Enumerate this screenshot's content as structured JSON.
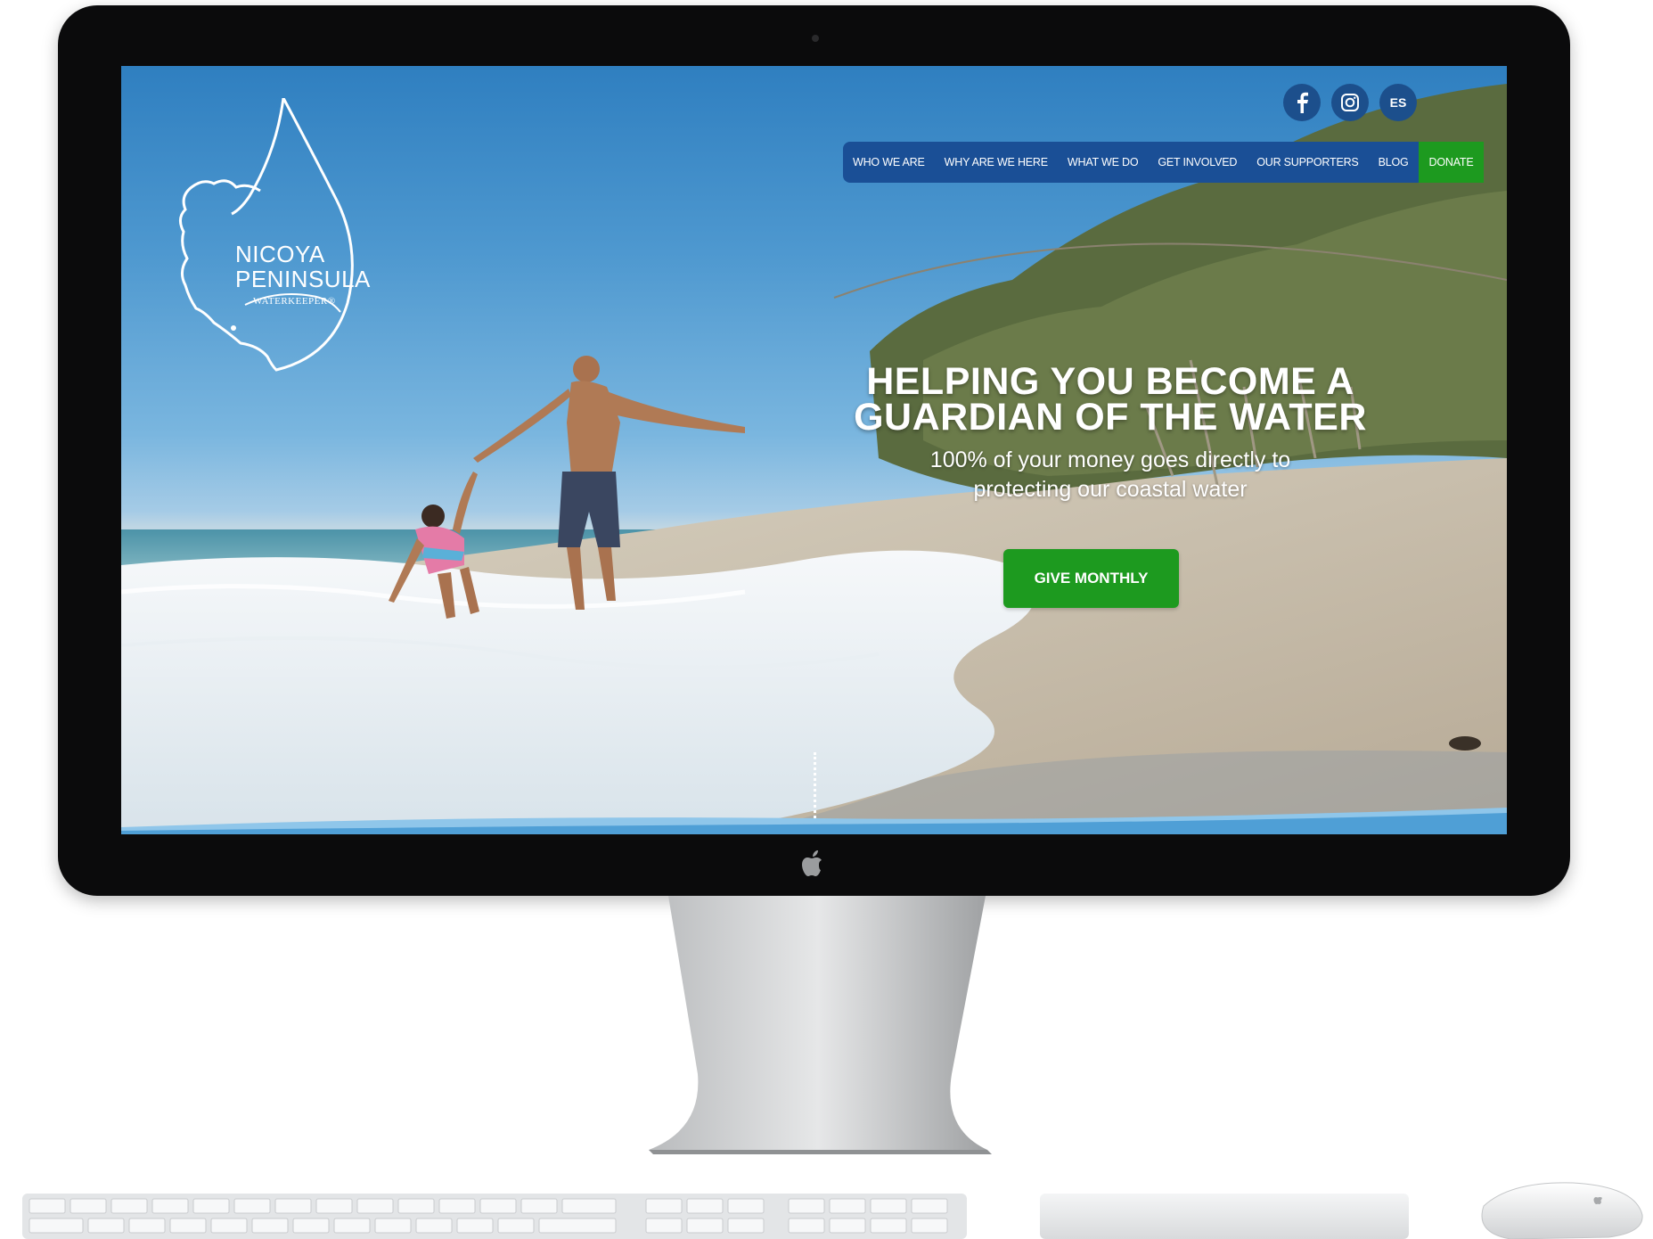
{
  "brand": {
    "logo_line1": "NICOYA",
    "logo_line2": "PENINSULA",
    "logo_line3": "WATERKEEPER®"
  },
  "social": {
    "facebook_icon": "facebook-icon",
    "instagram_icon": "instagram-icon",
    "language_label": "ES"
  },
  "nav": {
    "items": [
      "WHO WE ARE",
      "WHY ARE WE HERE",
      "WHAT WE DO",
      "GET INVOLVED",
      "OUR SUPPORTERS",
      "BLOG"
    ],
    "donate_label": "DONATE"
  },
  "hero": {
    "title_line1": "HELPING YOU BECOME A",
    "title_line2": "GUARDIAN OF THE WATER",
    "subtitle_line1": "100% of your money goes directly to",
    "subtitle_line2": "protecting our coastal water",
    "cta_label": "GIVE MONTHLY"
  },
  "colors": {
    "nav_blue": "#1a4f96",
    "donate_green": "#1d9a1f",
    "social_circle": "#1c4f8c"
  }
}
